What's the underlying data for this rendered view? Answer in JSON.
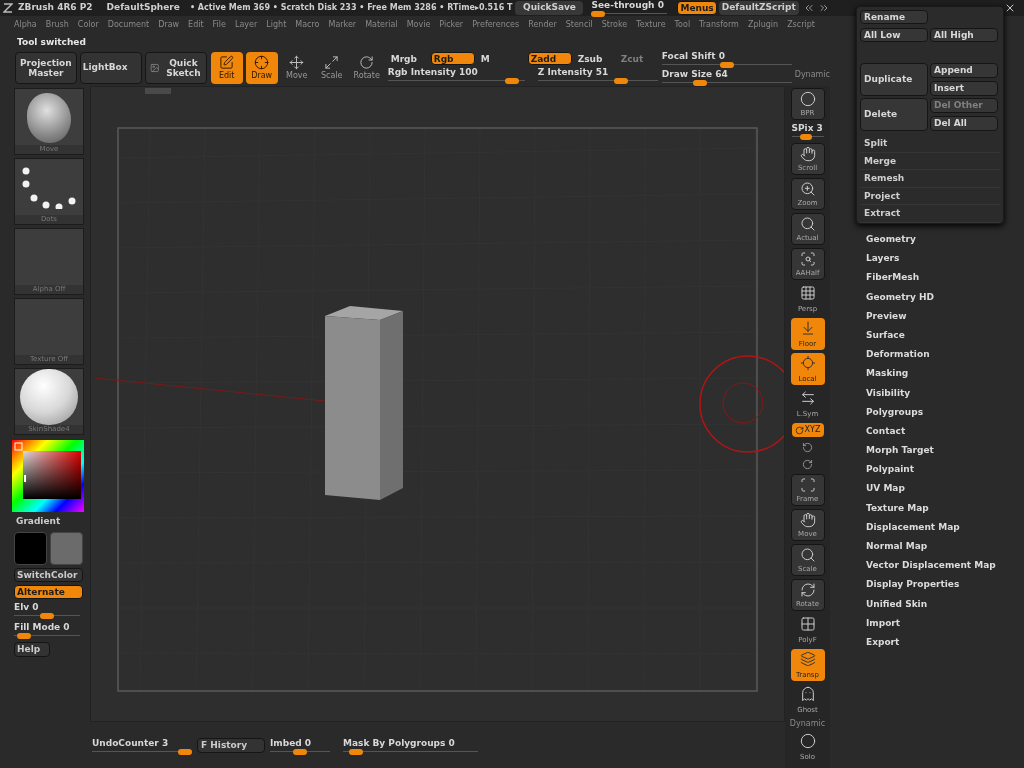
{
  "title_bar": {
    "app": "ZBrush 4R6 P2",
    "document": "DefaultSphere",
    "stats": "• Active Mem 369 • Scratch Disk 233 • Free Mem 3286 • RTime▸0.516 T",
    "quicksave": "QuickSave",
    "see_through": {
      "label": "See-through 0",
      "level": 0
    },
    "menus": {
      "label": "Menus",
      "on": true
    },
    "script": "DefaultZScript"
  },
  "menu_bar": [
    "Alpha",
    "Brush",
    "Color",
    "Document",
    "Draw",
    "Edit",
    "File",
    "Layer",
    "Light",
    "Macro",
    "Marker",
    "Material",
    "Movie",
    "Picker",
    "Preferences",
    "Render",
    "Stencil",
    "Stroke",
    "Texture",
    "Tool",
    "Transform",
    "Zplugin",
    "Zscript"
  ],
  "status": "Tool switched",
  "toolbar": {
    "projection_master": "Projection Master",
    "lightbox": "LightBox",
    "quick_sketch": "Quick Sketch",
    "modes": [
      {
        "label": "Edit",
        "on": true
      },
      {
        "label": "Draw",
        "on": true
      },
      {
        "label": "Move",
        "on": false
      },
      {
        "label": "Scale",
        "on": false
      },
      {
        "label": "Rotate",
        "on": false
      }
    ],
    "rgb_modes": [
      {
        "label": "Mrgb",
        "on": false
      },
      {
        "label": "Rgb",
        "on": true
      },
      {
        "label": "M",
        "on": false
      }
    ],
    "z_modes": [
      {
        "label": "Zadd",
        "on": true,
        "disabled": false
      },
      {
        "label": "Zsub",
        "on": false,
        "disabled": false
      },
      {
        "label": "Zcut",
        "on": false,
        "disabled": true
      }
    ],
    "rgb_intensity": {
      "label": "Rgb Intensity 100",
      "level": 0.95
    },
    "z_intensity": {
      "label": "Z Intensity 51",
      "level": 0.72
    },
    "focal_shift": {
      "label": "Focal Shift 0",
      "level": 0.5
    },
    "draw_size": {
      "label": "Draw Size 64",
      "level": 0.27
    },
    "dynamic": "Dynamic"
  },
  "left_panel": {
    "thumbnails": [
      {
        "kind": "brush",
        "label": "Move"
      },
      {
        "kind": "stroke",
        "label": "Dots"
      },
      {
        "kind": "empty",
        "label": "Alpha Off"
      },
      {
        "kind": "empty",
        "label": "Texture Off"
      },
      {
        "kind": "material",
        "label": "SkinShade4"
      }
    ],
    "gradient": "Gradient",
    "swatches": [
      {
        "color": "#000000"
      },
      {
        "color": "#6b6b6b"
      }
    ],
    "switch_color": "SwitchColor",
    "alternate": {
      "label": "Alternate",
      "on": true
    },
    "elv": {
      "label": "Elv 0",
      "level": 0.5
    },
    "fill_mode": {
      "label": "Fill Mode 0",
      "level": 0.05
    },
    "help": "Help"
  },
  "shelf": [
    {
      "kind": "button",
      "label": "BPR",
      "on": false
    },
    {
      "kind": "slider",
      "label": "SPix 3",
      "level": 0.4
    },
    {
      "kind": "button",
      "label": "Scroll",
      "on": false
    },
    {
      "kind": "button",
      "label": "Zoom",
      "on": false
    },
    {
      "kind": "button",
      "label": "Actual",
      "on": false
    },
    {
      "kind": "button",
      "label": "AAHalf",
      "on": false
    },
    {
      "kind": "flat",
      "label": "Persp",
      "on": false
    },
    {
      "kind": "button",
      "label": "Floor",
      "on": true
    },
    {
      "kind": "button",
      "label": "Local",
      "on": true
    },
    {
      "kind": "flat",
      "label": "L.Sym",
      "on": false
    },
    {
      "kind": "small",
      "label": "XYZ",
      "on": true
    },
    {
      "kind": "icon",
      "on": false
    },
    {
      "kind": "icon",
      "on": false
    },
    {
      "kind": "button",
      "label": "Frame",
      "on": false
    },
    {
      "kind": "button",
      "label": "Move",
      "on": false
    },
    {
      "kind": "button",
      "label": "Scale",
      "on": false
    },
    {
      "kind": "button",
      "label": "Rotate",
      "on": false
    },
    {
      "kind": "flat",
      "label": "PolyF",
      "on": false
    },
    {
      "kind": "button",
      "label": "Transp",
      "on": true
    },
    {
      "kind": "flat",
      "label": "Ghost",
      "on": false
    },
    {
      "kind": "caption",
      "label": "Dynamic"
    },
    {
      "kind": "flat",
      "label": "Solo",
      "on": false
    }
  ],
  "popup": {
    "rename": "Rename",
    "all_low": "All Low",
    "all_high": "All High",
    "duplicate": "Duplicate",
    "append": "Append",
    "insert": "Insert",
    "delete": "Delete",
    "del_other": {
      "label": "Del Other",
      "disabled": true
    },
    "del_all": "Del All",
    "items": [
      "Split",
      "Merge",
      "Remesh",
      "Project",
      "Extract"
    ]
  },
  "subpalettes": [
    "Geometry",
    "Layers",
    "FiberMesh",
    "Geometry HD",
    "Preview",
    "Surface",
    "Deformation",
    "Masking",
    "Visibility",
    "Polygroups",
    "Contact",
    "Morph Target",
    "Polypaint",
    "UV Map",
    "Texture Map",
    "Displacement Map",
    "Normal Map",
    "Vector Displacement Map",
    "Display Properties",
    "Unified Skin",
    "Import",
    "Export"
  ],
  "bottom_bar": {
    "undo": {
      "label": "UndoCounter 3",
      "level": 1
    },
    "history": "F History",
    "imbed": {
      "label": "Imbed 0",
      "level": 0.5
    },
    "mask": {
      "label": "Mask By Polygroups 0",
      "level": 0.05
    }
  }
}
